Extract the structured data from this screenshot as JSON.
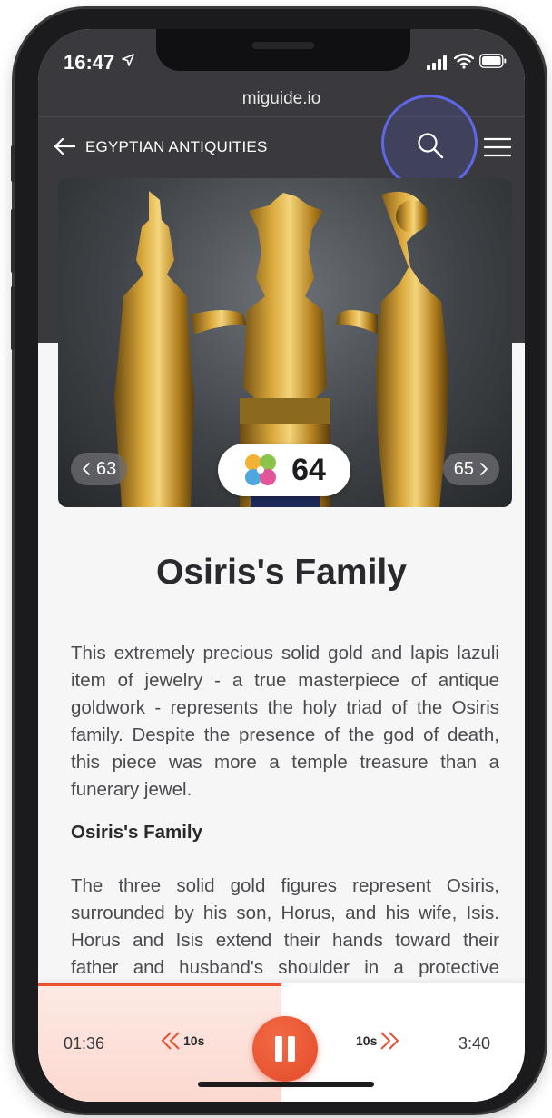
{
  "status_bar": {
    "time": "16:47"
  },
  "browser": {
    "url": "miguide.io"
  },
  "nav": {
    "title": "EGYPTIAN ANTIQUITIES"
  },
  "hero": {
    "prev_number": "63",
    "current_number": "64",
    "next_number": "65"
  },
  "article": {
    "title": "Osiris's Family",
    "paragraph_1": "This extremely precious solid gold and lapis lazuli item of jewelry - a true masterpiece of antique goldwork - represents the holy triad of the Osiris family. Despite the presence of the god of death, this piece was more a temple treasure than a funerary jewel.",
    "subheading": "Osiris's Family",
    "paragraph_2": "The three solid gold figures represent Osiris, surrounded by his son, Horus, and his wife, Isis. Horus and Isis extend their hands toward their father and husband's shoulder in a protective gesture. These gods are recognizable by their"
  },
  "player": {
    "elapsed": "01:36",
    "total": "3:40",
    "rewind_label": "10s",
    "forward_label": "10s",
    "progress_fraction": 0.5,
    "accent_color": "#e9512f"
  },
  "colors": {
    "header_bg": "#3a3a3e",
    "highlight_ring": "#5f67e8"
  }
}
